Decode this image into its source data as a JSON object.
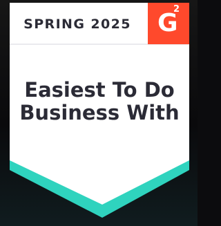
{
  "badge": {
    "season": "SPRING 2025",
    "logo_mark": "G",
    "logo_superscript": "2",
    "title_line1": "Easiest To Do",
    "title_line2": "Business With"
  },
  "colors": {
    "badge_face": "#ffffff",
    "logo_red": "#ff492c",
    "accent_teal": "#2fd3be",
    "text_dark": "#2b2b36",
    "background": "#0c0c0e"
  },
  "icons": {
    "logo": "g2-logo-icon"
  }
}
